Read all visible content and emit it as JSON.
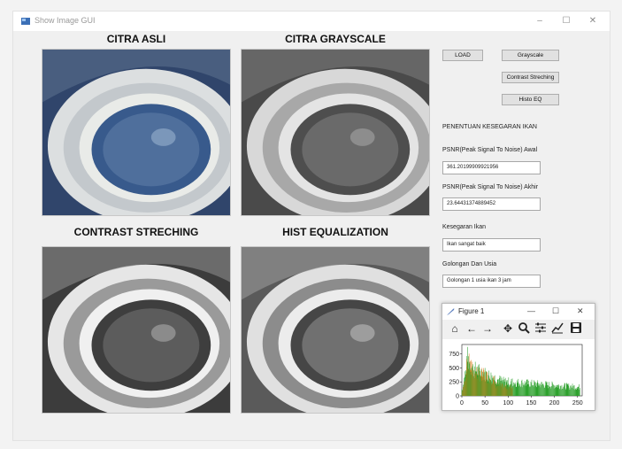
{
  "window": {
    "title": "Show Image GUI",
    "controls": [
      "–",
      "☐",
      "✕"
    ]
  },
  "panels": {
    "original": "CITRA ASLI",
    "grayscale": "CITRA GRAYSCALE",
    "contrast": "CONTRAST STRECHING",
    "histeq": "HIST EQUALIZATION"
  },
  "buttons": {
    "load": "LOAD",
    "grayscale": "Grayscale",
    "contrast": "Contrast Streching",
    "histeq": "Histo EQ"
  },
  "info": {
    "section_title": "PENENTUAN KESEGARAN IKAN",
    "psnr_awal_label": "PSNR(Peak Signal To Noise) Awal",
    "psnr_awal_value": "361.20199909921956",
    "psnr_akhir_label": "PSNR(Peak Signal To Noise) Akhir",
    "psnr_akhir_value": "23.64431374889452",
    "kesegaran_label": "Kesegaran Ikan",
    "kesegaran_value": "Ikan sangat baik",
    "golongan_label": "Golongan Dan Usia",
    "golongan_value": "Golongan 1 usia ikan 3 jam"
  },
  "figure": {
    "title": "Figure 1",
    "controls": [
      "—",
      "☐",
      "✕"
    ],
    "tools": [
      "home-icon",
      "back-arrow-icon",
      "forward-arrow-icon",
      "pan-icon",
      "zoom-icon",
      "subplots-icon",
      "lines-icon",
      "save-icon"
    ]
  },
  "chart_data": {
    "type": "bar",
    "x_ticks": [
      "0",
      "50",
      "100",
      "150",
      "200",
      "250"
    ],
    "y_ticks": [
      "0",
      "250",
      "500",
      "750"
    ],
    "xlim": [
      0,
      260
    ],
    "ylim": [
      0,
      920
    ],
    "series_colors": {
      "orange": "#e07b1a",
      "green": "#2ca02c"
    }
  }
}
